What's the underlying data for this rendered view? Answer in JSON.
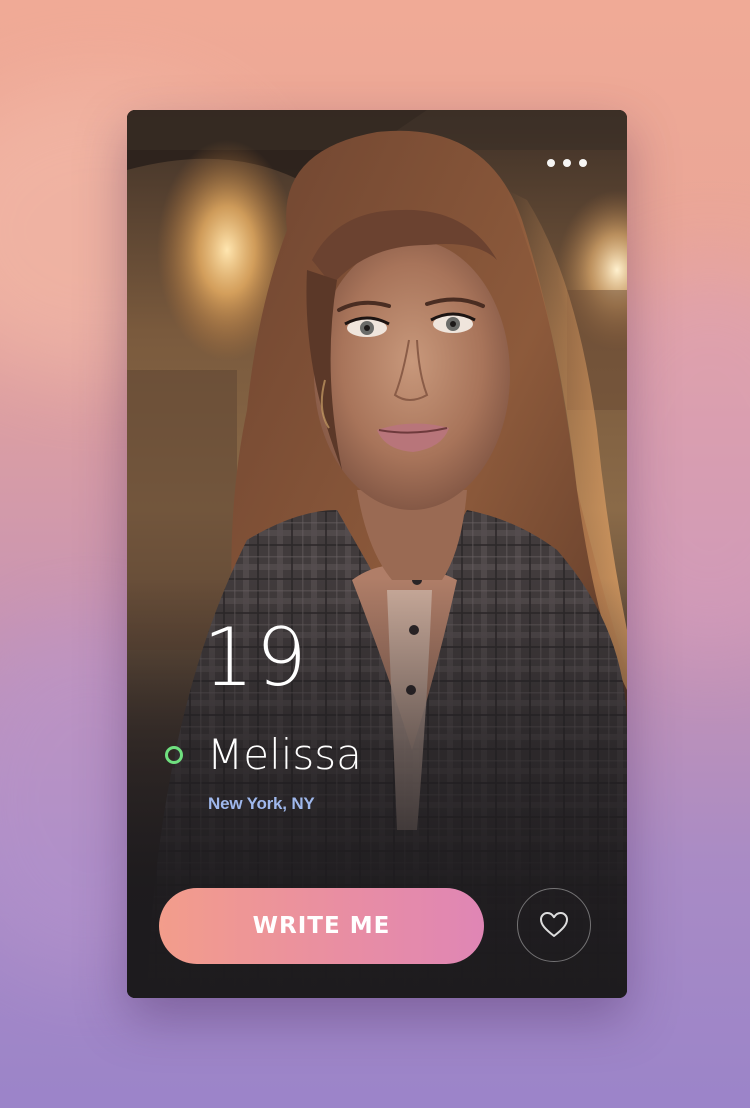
{
  "profile": {
    "age": "19",
    "name": "Melissa",
    "location": "New York, NY",
    "online": true
  },
  "actions": {
    "write_label": "WRITE ME",
    "menu_icon": "more-horizontal-icon",
    "like_icon": "heart-icon"
  },
  "colors": {
    "online_status": "#6fe07f",
    "location_text": "#9fb8ec",
    "button_gradient_start": "#f39d8b",
    "button_gradient_end": "#df86b5",
    "card_background": "#1c1a1d"
  }
}
